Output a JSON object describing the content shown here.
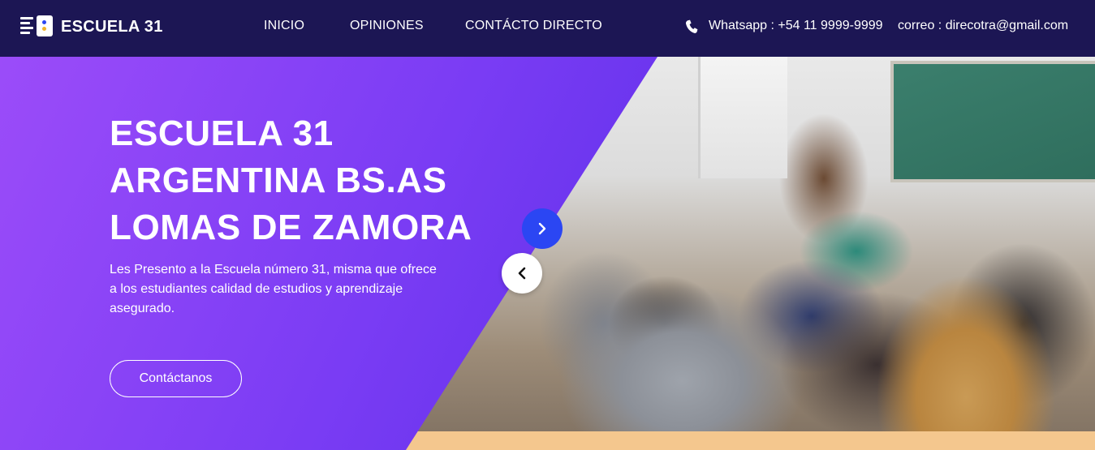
{
  "brand": {
    "name": "ESCUELA 31",
    "logo_icon": "school-logo-icon"
  },
  "nav": {
    "items": [
      {
        "label": "INICIO"
      },
      {
        "label": "OPINIONES"
      },
      {
        "label": "CONTÁCTO DIRECTO"
      }
    ]
  },
  "contact": {
    "phone_icon": "phone-icon",
    "whatsapp": "Whatsapp : +54 11 9999-9999",
    "email": "correo : direcotra@gmail.com"
  },
  "hero": {
    "title_lines": [
      "ESCUELA 31",
      "ARGENTINA BS.AS",
      "LOMAS DE ZAMORA"
    ],
    "description": "Les Presento a la Escuela número 31, misma que ofrece a los estudiantes calidad de estudios y aprendizaje asegurado.",
    "button_label": "Contáctanos",
    "image": "classroom-photo"
  },
  "slider": {
    "next_icon": "chevron-right-icon",
    "prev_icon": "chevron-left-icon"
  },
  "colors": {
    "navbar": "#1c1654",
    "hero_gradient_start": "#9b4cf9",
    "hero_gradient_end": "#4a2ad8",
    "next_button": "#2b46f3",
    "prev_button": "#ffffff"
  }
}
